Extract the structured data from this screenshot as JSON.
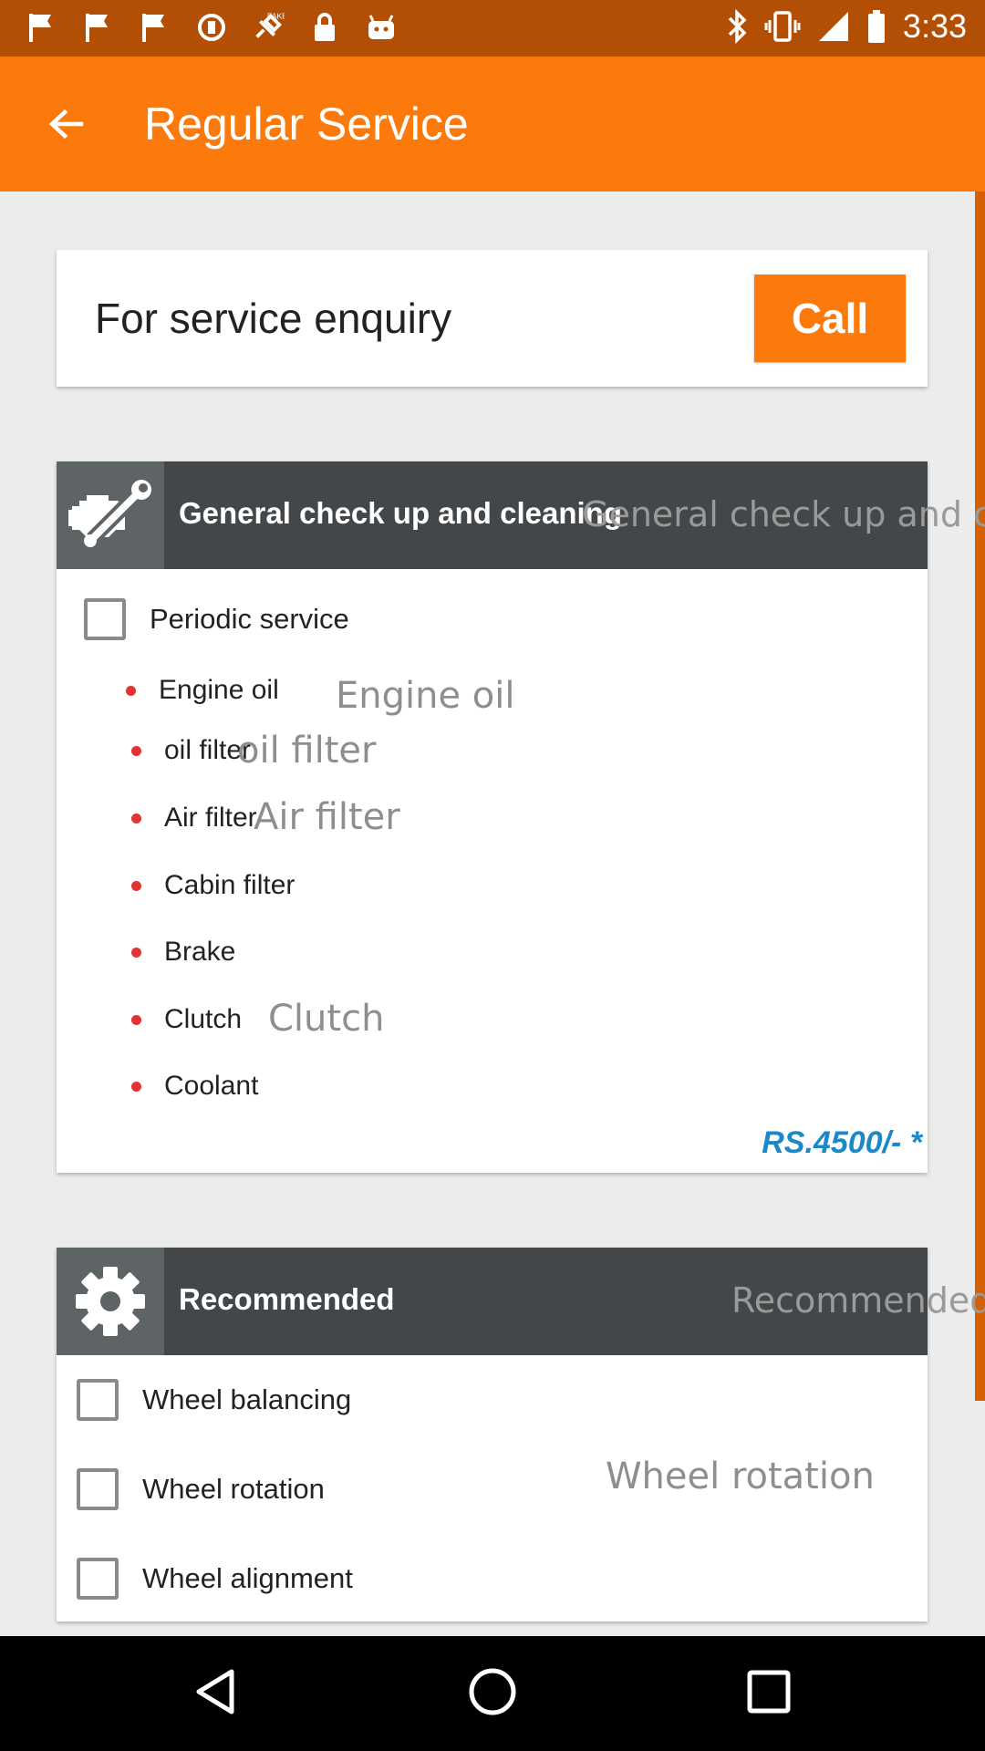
{
  "status_bar": {
    "time": "3:33",
    "left_icons": [
      "flag-icon",
      "flag-icon",
      "flag-icon",
      "sync-icon",
      "fake-gps-icon",
      "lock-icon",
      "android-icon"
    ],
    "right_icons": [
      "bluetooth-icon",
      "vibrate-icon",
      "signal-icon",
      "battery-icon"
    ]
  },
  "app_bar": {
    "title": "Regular Service",
    "back_icon": "arrow-back-icon",
    "color": "#fb7a0b"
  },
  "enquiry": {
    "text": "For service enquiry",
    "call_label": "Call"
  },
  "general_section": {
    "title": "General check up and cleaning",
    "ghost_title": "General check up and c",
    "icon": "engine-wrench-icon",
    "periodic_label": "Periodic service",
    "items": [
      {
        "label": "Engine oil",
        "ghost": "Engine oil"
      },
      {
        "label": "oil filter",
        "ghost": "oil filter"
      },
      {
        "label": "Air filter",
        "ghost": "Air filter"
      },
      {
        "label": "Cabin filter",
        "ghost": ""
      },
      {
        "label": "Brake",
        "ghost": ""
      },
      {
        "label": "Clutch",
        "ghost": "Clutch"
      },
      {
        "label": "Coolant",
        "ghost": ""
      }
    ],
    "price": "RS.4500/- *",
    "price_color": "#1b88c8"
  },
  "recommended_section": {
    "title": "Recommended",
    "ghost_title": "Recommended",
    "icon": "gear-icon",
    "options": [
      {
        "label": "Wheel balancing",
        "ghost": ""
      },
      {
        "label": "Wheel rotation",
        "ghost": "Wheel rotation"
      },
      {
        "label": "Wheel alignment",
        "ghost": ""
      }
    ]
  },
  "nav_bar": {
    "buttons": [
      "back-triangle-icon",
      "home-circle-icon",
      "recents-square-icon"
    ]
  }
}
